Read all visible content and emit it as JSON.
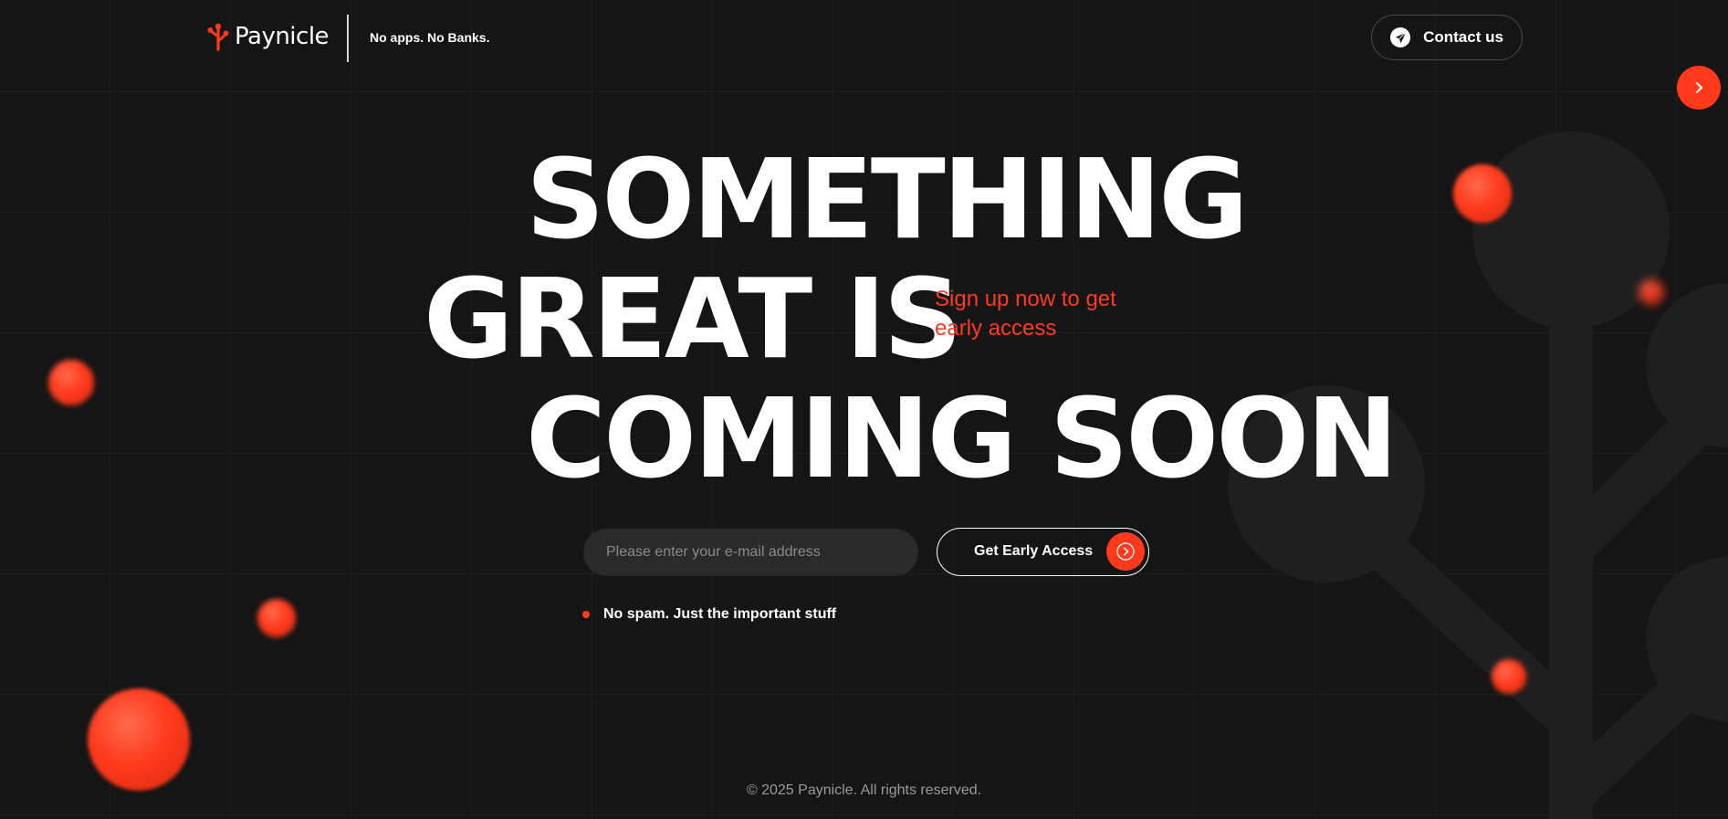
{
  "colors": {
    "background": "#151515",
    "accent": "#ff3a1c",
    "text": "#ffffff",
    "muted": "#9a9a9a"
  },
  "header": {
    "logo_text": "Paynicle",
    "logo_icon": "branch-logo-icon",
    "tagline": "No apps. No Banks.",
    "contact_label": "Contact us",
    "contact_icon": "paper-plane-icon"
  },
  "side_nav": {
    "icon": "chevron-right-icon"
  },
  "hero": {
    "line1": "SOMETHING",
    "line2": "GREAT IS",
    "line3": "COMING SOON",
    "signup_note": "Sign up now to get early access"
  },
  "form": {
    "email_placeholder": "Please enter your e-mail address",
    "email_value": "",
    "cta_label": "Get Early Access",
    "cta_icon": "circle-chevron-right-icon",
    "note": "No spam. Just the important stuff"
  },
  "footer": {
    "copyright": "© 2025 Paynicle. All rights reserved."
  }
}
